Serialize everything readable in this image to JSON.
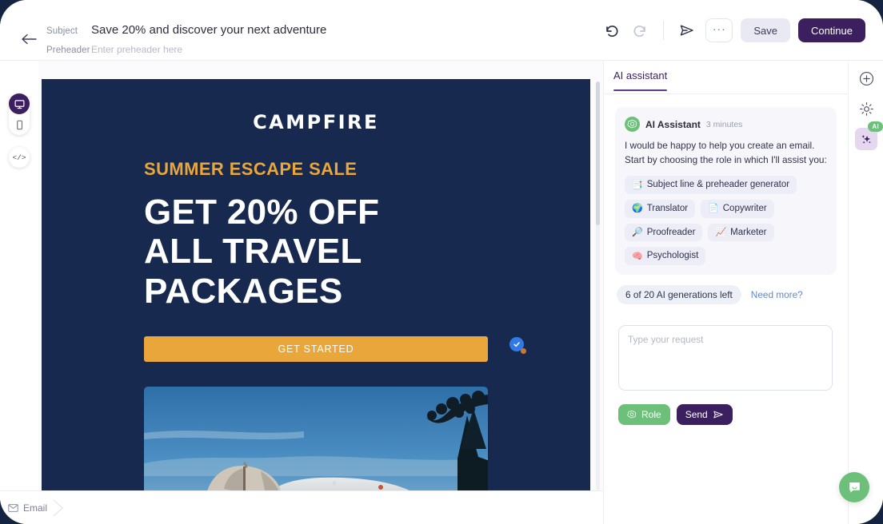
{
  "topbar": {
    "back_icon": "arrow-left-icon",
    "subject_label": "Subject",
    "subject_value": "Save 20% and discover your next adventure",
    "preheader_label": "Preheader",
    "preheader_placeholder": "Enter preheader here",
    "undo_icon": "undo-icon",
    "redo_icon": "redo-icon",
    "send_icon": "send-icon",
    "more_label": "···",
    "save_label": "Save",
    "continue_label": "Continue"
  },
  "left_rail": {
    "desktop_icon": "desktop-icon",
    "mobile_icon": "mobile-icon",
    "code_label": "</>"
  },
  "email": {
    "logo": "CAMPFIRE",
    "kicker": "SUMMER ESCAPE SALE",
    "headline_lines": [
      "GET 20% OFF",
      "ALL TRAVEL",
      "PACKAGES"
    ],
    "cta_label": "GET STARTED",
    "background_color": "#17294e",
    "accent_color": "#e9a73b",
    "photo_alt": "Airstream trailer with patio umbrella at dusk"
  },
  "bottom": {
    "email_tab_label": "Email",
    "email_tab_icon": "envelope-icon"
  },
  "ai_panel": {
    "tab_label": "AI assistant",
    "message": {
      "author": "AI Assistant",
      "time": "3 minutes",
      "text": "I would be happy to help you create an email. Start by choosing the role in which I'll assist you:"
    },
    "roles": [
      {
        "emoji": "📑",
        "label": "Subject line & preheader generator"
      },
      {
        "emoji": "🌍",
        "label": "Translator"
      },
      {
        "emoji": "📄",
        "label": "Copywriter"
      },
      {
        "emoji": "🔎",
        "label": "Proofreader"
      },
      {
        "emoji": "📈",
        "label": "Marketer"
      },
      {
        "emoji": "🧠",
        "label": "Psychologist"
      }
    ],
    "generations_label": "6 of 20 AI generations left",
    "need_more_label": "Need more?",
    "input_placeholder": "Type your request",
    "input_value": "",
    "role_button_label": "Role",
    "send_button_label": "Send"
  },
  "right_rail": {
    "add_icon": "plus-icon",
    "settings_icon": "gear-icon",
    "ai_icon": "sparkles-icon",
    "ai_badge": "AI"
  },
  "widget": {
    "chat_icon": "chat-bubble-icon"
  },
  "colors": {
    "brand_purple": "#3b1f5e",
    "accent_green": "#6cc07a",
    "email_navy": "#17294e",
    "email_gold": "#e9a73b",
    "link_blue": "#5c87e0"
  }
}
